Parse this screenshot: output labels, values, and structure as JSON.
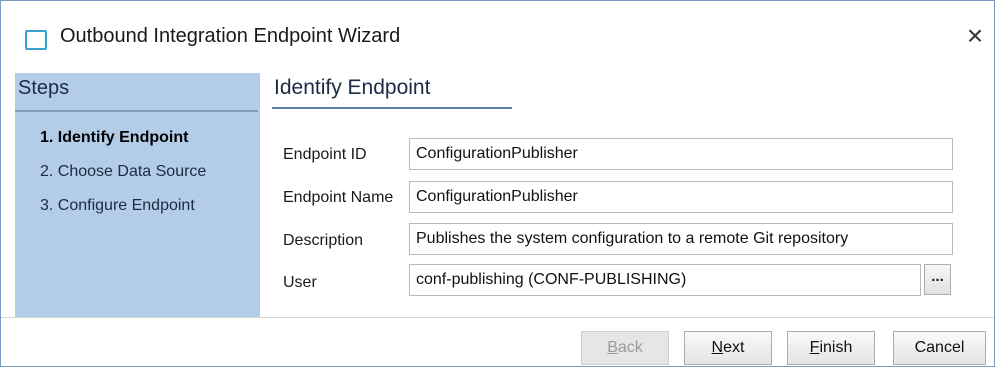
{
  "window": {
    "title": "Outbound Integration Endpoint Wizard",
    "close_glyph": "×"
  },
  "steps": {
    "title": "Steps",
    "items": [
      {
        "label": "1. Identify Endpoint",
        "active": true
      },
      {
        "label": "2. Choose Data Source",
        "active": false
      },
      {
        "label": "3. Configure Endpoint",
        "active": false
      }
    ]
  },
  "section": {
    "title": "Identify Endpoint"
  },
  "form": {
    "endpoint_id": {
      "label": "Endpoint ID",
      "value": "ConfigurationPublisher"
    },
    "endpoint_name": {
      "label": "Endpoint Name",
      "value": "ConfigurationPublisher"
    },
    "description": {
      "label": "Description",
      "value": "Publishes the system configuration to a remote Git repository"
    },
    "user": {
      "label": "User",
      "value": "conf-publishing (CONF-PUBLISHING)",
      "browse_label": "..."
    }
  },
  "buttons": {
    "back": {
      "first": "B",
      "rest": "ack",
      "enabled": false
    },
    "next": {
      "first": "N",
      "rest": "ext",
      "enabled": true
    },
    "finish": {
      "first": "F",
      "rest": "inish",
      "enabled": true
    },
    "cancel": {
      "label": "Cancel",
      "enabled": true
    }
  },
  "colors": {
    "steps_panel": "#b3cce8",
    "accent_icon": "#33a3cf"
  },
  "icons": {
    "window_icon": "window-square-icon",
    "close": "close-icon"
  }
}
